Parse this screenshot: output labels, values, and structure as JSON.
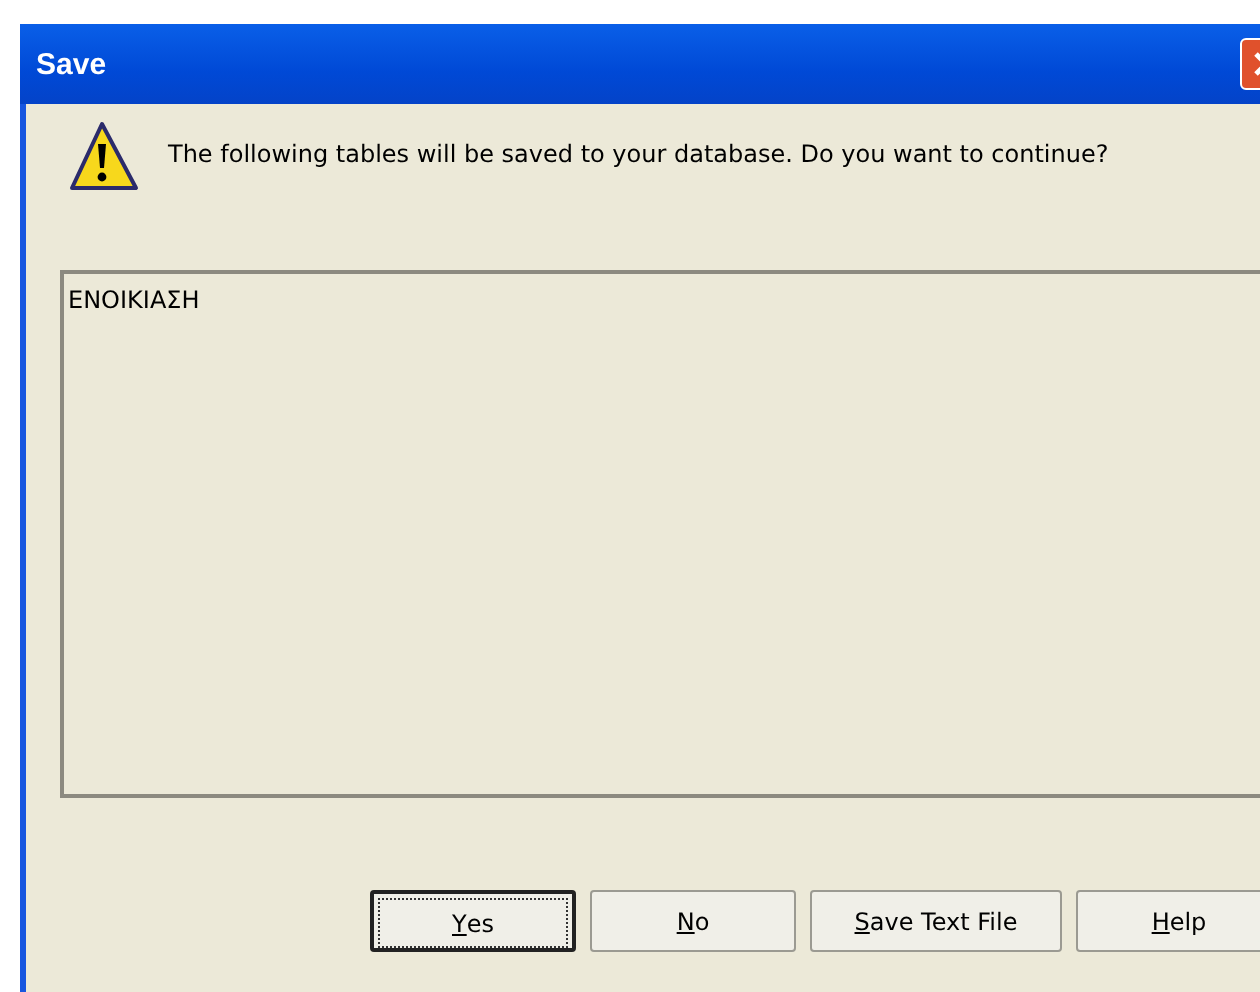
{
  "window": {
    "title": "Save"
  },
  "message": "The following tables will be saved to your database. Do you want to continue?",
  "tables": [
    "ΕΝΟΙΚΙΑΣΗ"
  ],
  "buttons": [
    {
      "mnemonic": "Y",
      "after": "es",
      "default": true
    },
    {
      "mnemonic": "N",
      "after": "o",
      "default": false
    },
    {
      "mnemonic": "S",
      "after": "ave Text File",
      "default": false
    },
    {
      "mnemonic": "H",
      "after": "elp",
      "default": false
    }
  ]
}
